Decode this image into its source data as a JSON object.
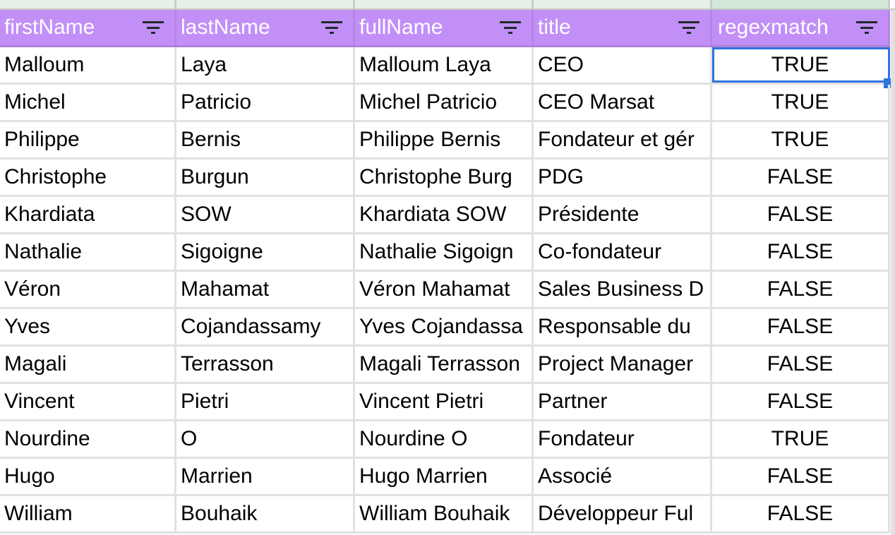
{
  "columns": [
    "firstName",
    "lastName",
    "fullName",
    "title",
    "regexmatch"
  ],
  "selected_cell": {
    "row": 0,
    "column": "regexmatch"
  },
  "accent_colors": {
    "header": "#c28ff7",
    "selection": "#2f73e0"
  },
  "rows": [
    [
      "Malloum",
      "Laya",
      "Malloum Laya",
      "CEO",
      "TRUE"
    ],
    [
      "Michel",
      "Patricio",
      "Michel Patricio",
      "CEO Marsat",
      "TRUE"
    ],
    [
      "Philippe",
      "Bernis",
      "Philippe Bernis",
      "Fondateur et gér",
      "TRUE"
    ],
    [
      "Christophe",
      "Burgun",
      "Christophe Burg",
      "PDG",
      "FALSE"
    ],
    [
      "Khardiata",
      "SOW",
      "Khardiata SOW",
      "Présidente",
      "FALSE"
    ],
    [
      "Nathalie",
      "Sigoigne",
      "Nathalie Sigoign",
      "Co-fondateur",
      "FALSE"
    ],
    [
      "Véron",
      "Mahamat",
      "Véron Mahamat",
      "Sales Business D",
      "FALSE"
    ],
    [
      "Yves",
      "Cojandassamy",
      "Yves Cojandassa",
      "Responsable du",
      "FALSE"
    ],
    [
      "Magali",
      "Terrasson",
      "Magali Terrasson",
      "Project Manager",
      "FALSE"
    ],
    [
      "Vincent",
      "Pietri",
      "Vincent Pietri",
      "Partner",
      "FALSE"
    ],
    [
      "Nourdine",
      "O",
      "Nourdine O",
      "Fondateur",
      "TRUE"
    ],
    [
      "Hugo",
      "Marrien",
      "Hugo Marrien",
      "Associé",
      "FALSE"
    ],
    [
      "William",
      "Bouhaik",
      "William Bouhaik",
      "Développeur Ful",
      "FALSE"
    ]
  ]
}
